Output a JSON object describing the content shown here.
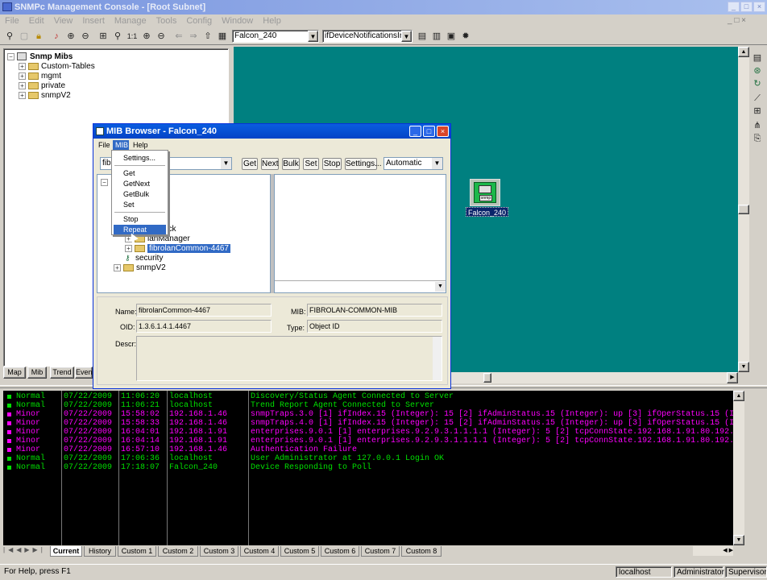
{
  "window": {
    "title": "SNMPc Management Console - [Root Subnet]"
  },
  "menubar": [
    "File",
    "Edit",
    "View",
    "Insert",
    "Manage",
    "Tools",
    "Config",
    "Window",
    "Help"
  ],
  "toolbar": {
    "device_combo": "Falcon_240",
    "mib_combo": "ifDeviceNotificationsInfo"
  },
  "tree": {
    "root": "Snmp Mibs",
    "items": [
      "Custom-Tables",
      "mgmt",
      "private",
      "snmpV2"
    ]
  },
  "left_tabs": [
    "Map",
    "Mib",
    "Trend",
    "Even"
  ],
  "map": {
    "device_label": "Falcon_240",
    "device_badge": "snmp"
  },
  "log": {
    "rows": [
      {
        "sev": "Normal",
        "date": "07/22/2009",
        "time": "11:06:20",
        "host": "localhost",
        "msg": "Discovery/Status Agent Connected to Server"
      },
      {
        "sev": "Normal",
        "date": "07/22/2009",
        "time": "11:06:21",
        "host": "localhost",
        "msg": "Trend Report Agent Connected to Server"
      },
      {
        "sev": "Minor",
        "date": "07/22/2009",
        "time": "15:58:02",
        "host": "192.168.1.46",
        "msg": "snmpTraps.3.0 [1] ifIndex.15 (Integer): 15 [2] ifAdminStatus.15 (Integer): up [3] ifOperStatus.15 (In"
      },
      {
        "sev": "Minor",
        "date": "07/22/2009",
        "time": "15:58:33",
        "host": "192.168.1.46",
        "msg": "snmpTraps.4.0 [1] ifIndex.15 (Integer): 15 [2] ifAdminStatus.15 (Integer): up [3] ifOperStatus.15 (In"
      },
      {
        "sev": "Minor",
        "date": "07/22/2009",
        "time": "16:04:01",
        "host": "192.168.1.91",
        "msg": "enterprises.9.0.1 [1] enterprises.9.2.9.3.1.1.1.1 (Integer): 5 [2] tcpConnState.192.168.1.91.80.192.1"
      },
      {
        "sev": "Minor",
        "date": "07/22/2009",
        "time": "16:04:14",
        "host": "192.168.1.91",
        "msg": "enterprises.9.0.1 [1] enterprises.9.2.9.3.1.1.1.1 (Integer): 5 [2] tcpConnState.192.168.1.91.80.192.1"
      },
      {
        "sev": "Minor",
        "date": "07/22/2009",
        "time": "16:57:10",
        "host": "192.168.1.46",
        "msg": "Authentication Failure"
      },
      {
        "sev": "Normal",
        "date": "07/22/2009",
        "time": "17:06:36",
        "host": "localhost",
        "msg": "User Administrator at 127.0.0.1 Login OK"
      },
      {
        "sev": "Normal",
        "date": "07/22/2009",
        "time": "17:18:07",
        "host": "Falcon_240",
        "msg": "Device Responding to Poll"
      }
    ]
  },
  "bottom_tabs": [
    "Current",
    "History",
    "Custom 1",
    "Custom 2",
    "Custom 3",
    "Custom 4",
    "Custom 5",
    "Custom 6",
    "Custom 7",
    "Custom 8"
  ],
  "status": {
    "help": "For Help, press F1",
    "host": "localhost",
    "user": "Administrator",
    "role": "Supervisor"
  },
  "mib_browser": {
    "title": "MIB Browser - Falcon_240",
    "menu": [
      "File",
      "MIB",
      "Help"
    ],
    "buttons": [
      "Get",
      "Next",
      "Bulk",
      "Set",
      "Stop",
      "Settings..."
    ],
    "combo_left": "fibr",
    "combo_mode": "Automatic",
    "tree": [
      "ock",
      "lanManager",
      "fibrolanCommon-4467",
      "security",
      "snmpV2"
    ],
    "name_label": "Name:",
    "name_value": "fibrolanCommon-4467",
    "mib_label": "MIB:",
    "mib_value": "FIBROLAN-COMMON-MIB",
    "oid_label": "OID:",
    "oid_value": "1.3.6.1.4.1.4467",
    "type_label": "Type:",
    "type_value": "Object ID",
    "descr_label": "Descr:"
  },
  "mib_menu": [
    "Settings...",
    "Get",
    "GetNext",
    "GetBulk",
    "Set",
    "Stop",
    "Repeat"
  ],
  "colors": {
    "map_bg": "#008080",
    "normal": "#00e000",
    "minor": "#ff00ff",
    "title": "#0a5de0"
  }
}
